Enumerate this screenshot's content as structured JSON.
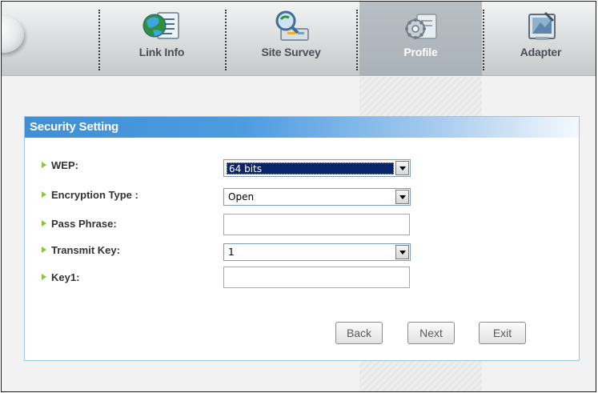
{
  "toolbar": {
    "tabs": [
      {
        "label": "Link Info",
        "icon": "globe-document-icon"
      },
      {
        "label": "Site Survey",
        "icon": "site-survey-icon"
      },
      {
        "label": "Profile",
        "icon": "gear-document-icon",
        "active": true
      },
      {
        "label": "Adapter",
        "icon": "adapter-icon"
      }
    ]
  },
  "panel": {
    "title": "Security Setting",
    "fields": [
      {
        "label": "WEP:",
        "type": "select",
        "value": "64 bits"
      },
      {
        "label": "Encryption Type :",
        "type": "select",
        "value": "Open"
      },
      {
        "label": "Pass Phrase:",
        "type": "text",
        "value": ""
      },
      {
        "label": "Transmit Key:",
        "type": "select",
        "value": "1"
      },
      {
        "label": "Key1:",
        "type": "text",
        "value": ""
      }
    ],
    "buttons": {
      "back": "Back",
      "next": "Next",
      "exit": "Exit"
    }
  },
  "colors": {
    "header_blue": "#3f8fd6",
    "bullet_green": "#8bc63f",
    "active_tab": "#aab2b9",
    "selection": "#0a246a"
  }
}
